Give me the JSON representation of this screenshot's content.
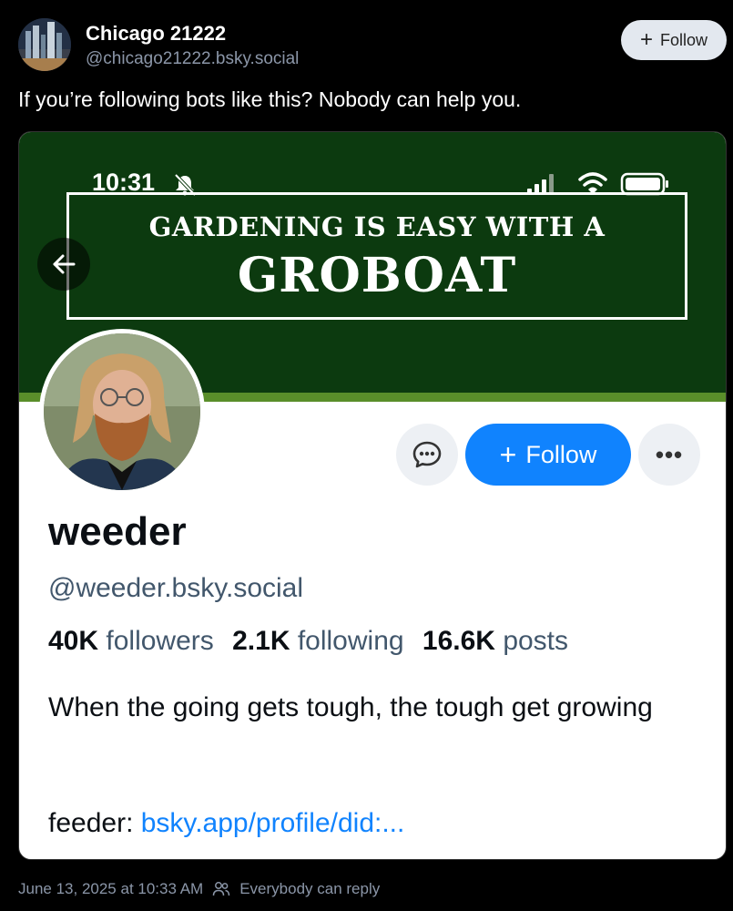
{
  "post": {
    "author_name": "Chicago 21222",
    "author_handle": "@chicago21222.bsky.social",
    "follow_label": "Follow",
    "text": "If you’re following bots like this? Nobody can help you.",
    "timestamp": "June 13, 2025 at 10:33 AM",
    "reply_setting": "Everybody can reply"
  },
  "screenshot": {
    "status_time": "10:31",
    "banner_line1": "GARDENING IS EASY WITH A",
    "banner_line2": "GROBOAT",
    "follow_label": "Follow",
    "display_name": "weeder",
    "handle": "@weeder.bsky.social",
    "stats": {
      "followers_count": "40K",
      "followers_label": "followers",
      "following_count": "2.1K",
      "following_label": "following",
      "posts_count": "16.6K",
      "posts_label": "posts"
    },
    "bio": "When the going gets tough, the tough get growing",
    "feeder_label": "feeder:",
    "feeder_link": "bsky.app/profile/did:..."
  },
  "icons": {
    "plus": "+",
    "more": "•••"
  },
  "colors": {
    "accent_blue": "#1083fe",
    "banner_green": "#0c3a0f",
    "muted_text": "#8b96a8"
  }
}
